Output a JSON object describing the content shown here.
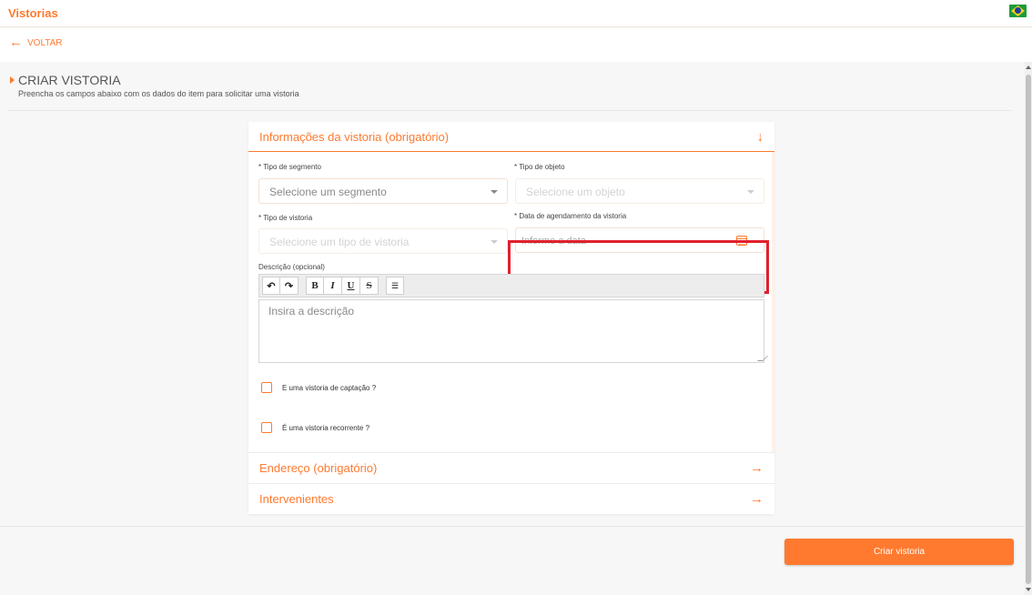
{
  "app": {
    "title": "Vistorias",
    "flag_icon": "brazil-flag-icon"
  },
  "nav": {
    "back_label": "VOLTAR",
    "back_icon": "arrow-left-icon"
  },
  "page": {
    "title": "CRIAR VISTORIA",
    "subtitle": "Preencha os campos abaixo com os dados do item para solicitar uma vistoria"
  },
  "sections": {
    "info": {
      "title": "Informações da vistoria (obrigatório)",
      "icon": "arrow-down-icon",
      "expanded": true
    },
    "address": {
      "title": "Endereço (obrigatório)",
      "icon": "arrow-right-icon"
    },
    "parties": {
      "title": "Intervenientes",
      "icon": "arrow-right-icon"
    }
  },
  "form": {
    "segment": {
      "label": "* Tipo de segmento",
      "placeholder": "Selecione um segmento"
    },
    "object": {
      "label": "* Tipo de objeto",
      "placeholder": "Selecione um objeto"
    },
    "inspection_type": {
      "label": "* Tipo de vistoria",
      "placeholder": "Selecione um tipo de vistoria"
    },
    "schedule_date": {
      "label": "* Data de agendamento da vistoria",
      "placeholder": "Informe a data",
      "icon": "calendar-icon"
    },
    "description": {
      "label": "Descrição (opcional)",
      "placeholder": "Insira a descrição",
      "toolbar": {
        "undo": "↶",
        "redo": "↷",
        "bold": "B",
        "italic": "I",
        "underline": "U",
        "strike": "S",
        "list": "☰"
      }
    },
    "capture_check": {
      "label": "E uma vistoria de captação ?",
      "checked": false
    },
    "recurring_check": {
      "label": "É uma vistoria recorrente ?",
      "checked": false
    }
  },
  "actions": {
    "submit_label": "Criar vistoria"
  },
  "colors": {
    "accent": "#ff7a2f",
    "highlight": "#e0202e"
  }
}
